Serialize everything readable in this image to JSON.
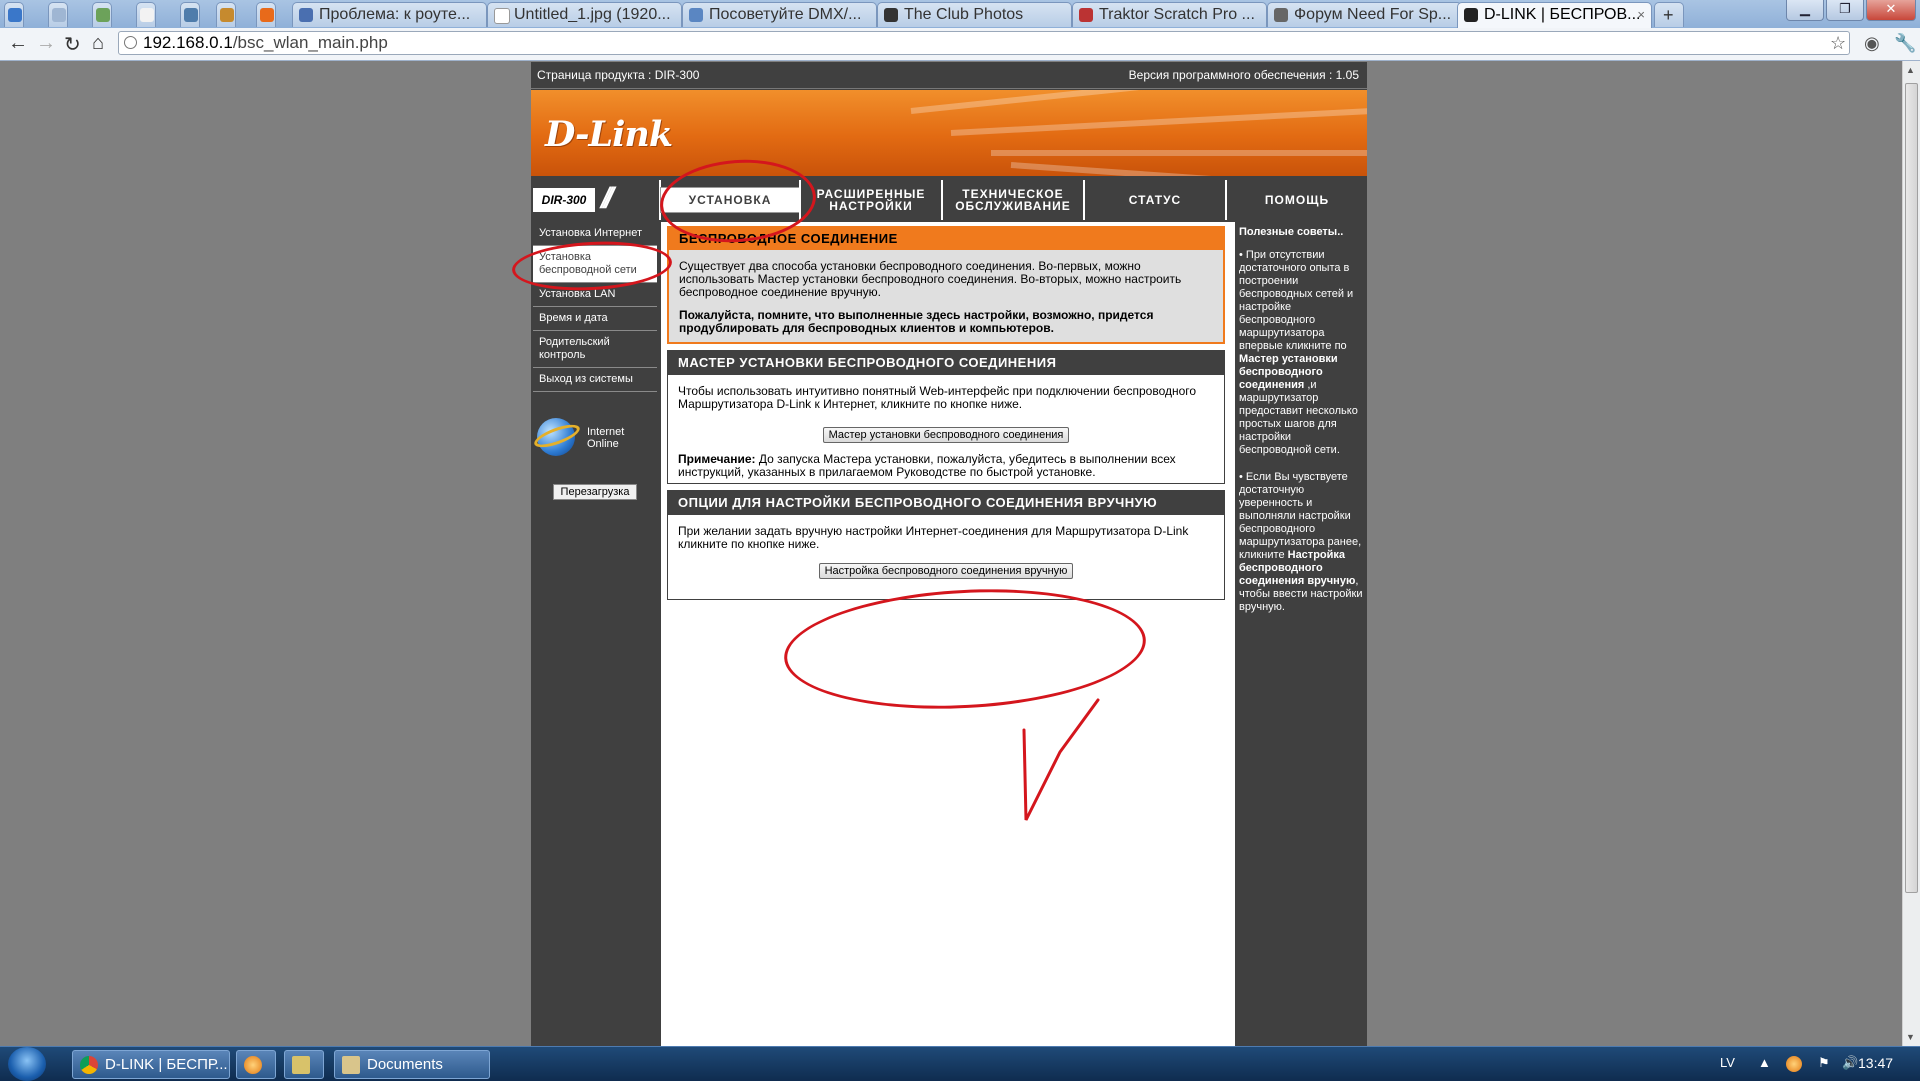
{
  "browser": {
    "tabs": [
      {
        "label": "Проблема: к роуте...",
        "active": false
      },
      {
        "label": "Untitled_1.jpg (1920...",
        "active": false
      },
      {
        "label": "Посоветуйте DMX/...",
        "active": false
      },
      {
        "label": "The Club Photos",
        "active": false
      },
      {
        "label": "Traktor Scratch Pro ...",
        "active": false
      },
      {
        "label": "Форум Need For Sp...",
        "active": false
      },
      {
        "label": "D-LINK | БЕСПРОВ...",
        "active": true
      }
    ],
    "new_tab": "+",
    "close_glyph": "×",
    "url_host": "192.168.0.1",
    "url_path": "/bsc_wlan_main.php"
  },
  "router": {
    "product_page_label": "Страница продукта :  DIR-300",
    "firmware_label": "Версия программного обеспечения : 1.05",
    "logo": "D-Link",
    "model_badge": "DIR-300",
    "model_slashes": "///",
    "nav_tabs": [
      {
        "label": "УСТАНОВКА",
        "selected": true
      },
      {
        "label": "РАСШИРЕННЫЕ НАСТРОЙКИ",
        "selected": false
      },
      {
        "label": "ТЕХНИЧЕСКОЕ ОБСЛУЖИВАНИЕ",
        "selected": false
      },
      {
        "label": "СТАТУС",
        "selected": false
      },
      {
        "label": "ПОМОЩЬ",
        "selected": false
      }
    ],
    "left_nav": [
      {
        "label": "Установка Интернет",
        "selected": false
      },
      {
        "label": "Установка беспроводной сети",
        "selected": true
      },
      {
        "label": "Установка LAN",
        "selected": false
      },
      {
        "label": "Время и дата",
        "selected": false
      },
      {
        "label": "Родительский контроль",
        "selected": false
      },
      {
        "label": "Выход из системы",
        "selected": false
      }
    ],
    "internet_status_line1": "Internet",
    "internet_status_line2": "Online",
    "reboot_button": "Перезагрузка",
    "sections": {
      "wireless": {
        "title": "БЕСПРОВОДНОЕ СОЕДИНЕНИЕ",
        "text": "Существует два способа установки беспроводного соединения. Во-первых, можно использовать Мастер установки беспроводного соединения. Во-вторых, можно настроить беспроводное соединение вручную.",
        "note": "Пожалуйста, помните, что выполненные здесь настройки, возможно, придется продублировать для беспроводных клиентов и компьютеров."
      },
      "wizard": {
        "title": "МАСТЕР УСТАНОВКИ БЕСПРОВОДНОГО СОЕДИНЕНИЯ",
        "text": "Чтобы использовать интуитивно понятный Web-интерфейс при подключении беспроводного Маршрутизатора D-Link к Интернет, кликните по кнопке ниже.",
        "button": "Мастер установки беспроводного соединения",
        "note_label": "Примечание:",
        "note": " До запуска Мастера установки, пожалуйста, убедитесь в выполнении всех инструкций, указанных в прилагаемом Руководстве по быстрой установке."
      },
      "manual": {
        "title": "ОПЦИИ ДЛЯ НАСТРОЙКИ БЕСПРОВОДНОГО СОЕДИНЕНИЯ ВРУЧНУЮ",
        "text": "При желании задать вручную настройки Интернет-соединения для Маршрутизатора D-Link кликните по кнопке ниже.",
        "button": "Настройка беспроводного соединения вручную"
      }
    },
    "tips": {
      "title": "Полезные советы..",
      "tip1_a": "• При отсутствии достаточного опыта в построении беспроводных сетей и настройке беспроводного маршрутизатора впервые кликните по ",
      "tip1_bold": "Мастер установки беспроводного соединения",
      "tip1_b": " ,и маршрутизатор предоставит несколько простых шагов для настройки беспроводной сети.",
      "tip2_a": "• Если Вы чувствуете достаточную уверенность и выполняли настройки беспроводного маршрутизатора ранее, кликните ",
      "tip2_bold": "Настройка беспроводного соединения вручную",
      "tip2_b": ", чтобы ввести настройки вручную."
    }
  },
  "taskbar": {
    "tasks": [
      {
        "label": "D-LINK | БЕСПР..."
      },
      {
        "label": "Documents"
      }
    ],
    "lang": "LV",
    "clock": "13:47"
  },
  "colors": {
    "dlink_orange": "#f07a1d",
    "dlink_dark": "#404040",
    "annotation_red": "#d4161d"
  }
}
